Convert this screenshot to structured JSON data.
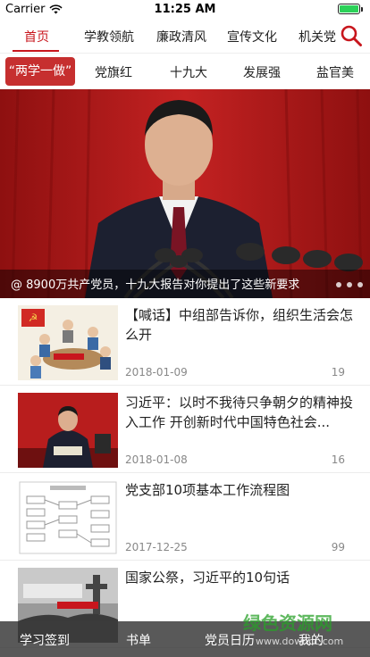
{
  "status_bar": {
    "carrier": "Carrier",
    "time": "11:25 AM",
    "battery_level": 1.0
  },
  "nav": {
    "items": [
      {
        "label": "首页",
        "active": true
      },
      {
        "label": "学教领航"
      },
      {
        "label": "廉政清风"
      },
      {
        "label": "宣传文化"
      },
      {
        "label": "机关党"
      }
    ],
    "search_icon": "search-icon",
    "accent": "#c8161d"
  },
  "sub_nav": {
    "items": [
      {
        "label": "“两学一做”",
        "active": true
      },
      {
        "label": "党旗红"
      },
      {
        "label": "十九大"
      },
      {
        "label": "发展强"
      },
      {
        "label": "盐官美"
      }
    ],
    "active_bg": "#c62f2f"
  },
  "banner": {
    "caption": "@ 8900万共产党员，十九大报告对你提出了这些新要求",
    "slide_count": 3
  },
  "news": [
    {
      "title": "【喊话】中组部告诉你，组织生活会怎么开",
      "date": "2018-01-09",
      "count": "19"
    },
    {
      "title": "习近平：以时不我待只争朝夕的精神投入工作 开创新时代中国特色社会...",
      "date": "2018-01-08",
      "count": "16"
    },
    {
      "title": "党支部10项基本工作流程图",
      "date": "2017-12-25",
      "count": "99"
    },
    {
      "title": "国家公祭，习近平的10句话",
      "date": "",
      "count": ""
    }
  ],
  "tabbar": {
    "items": [
      {
        "label": "学习签到"
      },
      {
        "label": "书单"
      },
      {
        "label": "党员日历"
      },
      {
        "label": "我的"
      }
    ]
  },
  "watermark": {
    "title": "绿色资源网",
    "url": "www.downcc.com"
  }
}
